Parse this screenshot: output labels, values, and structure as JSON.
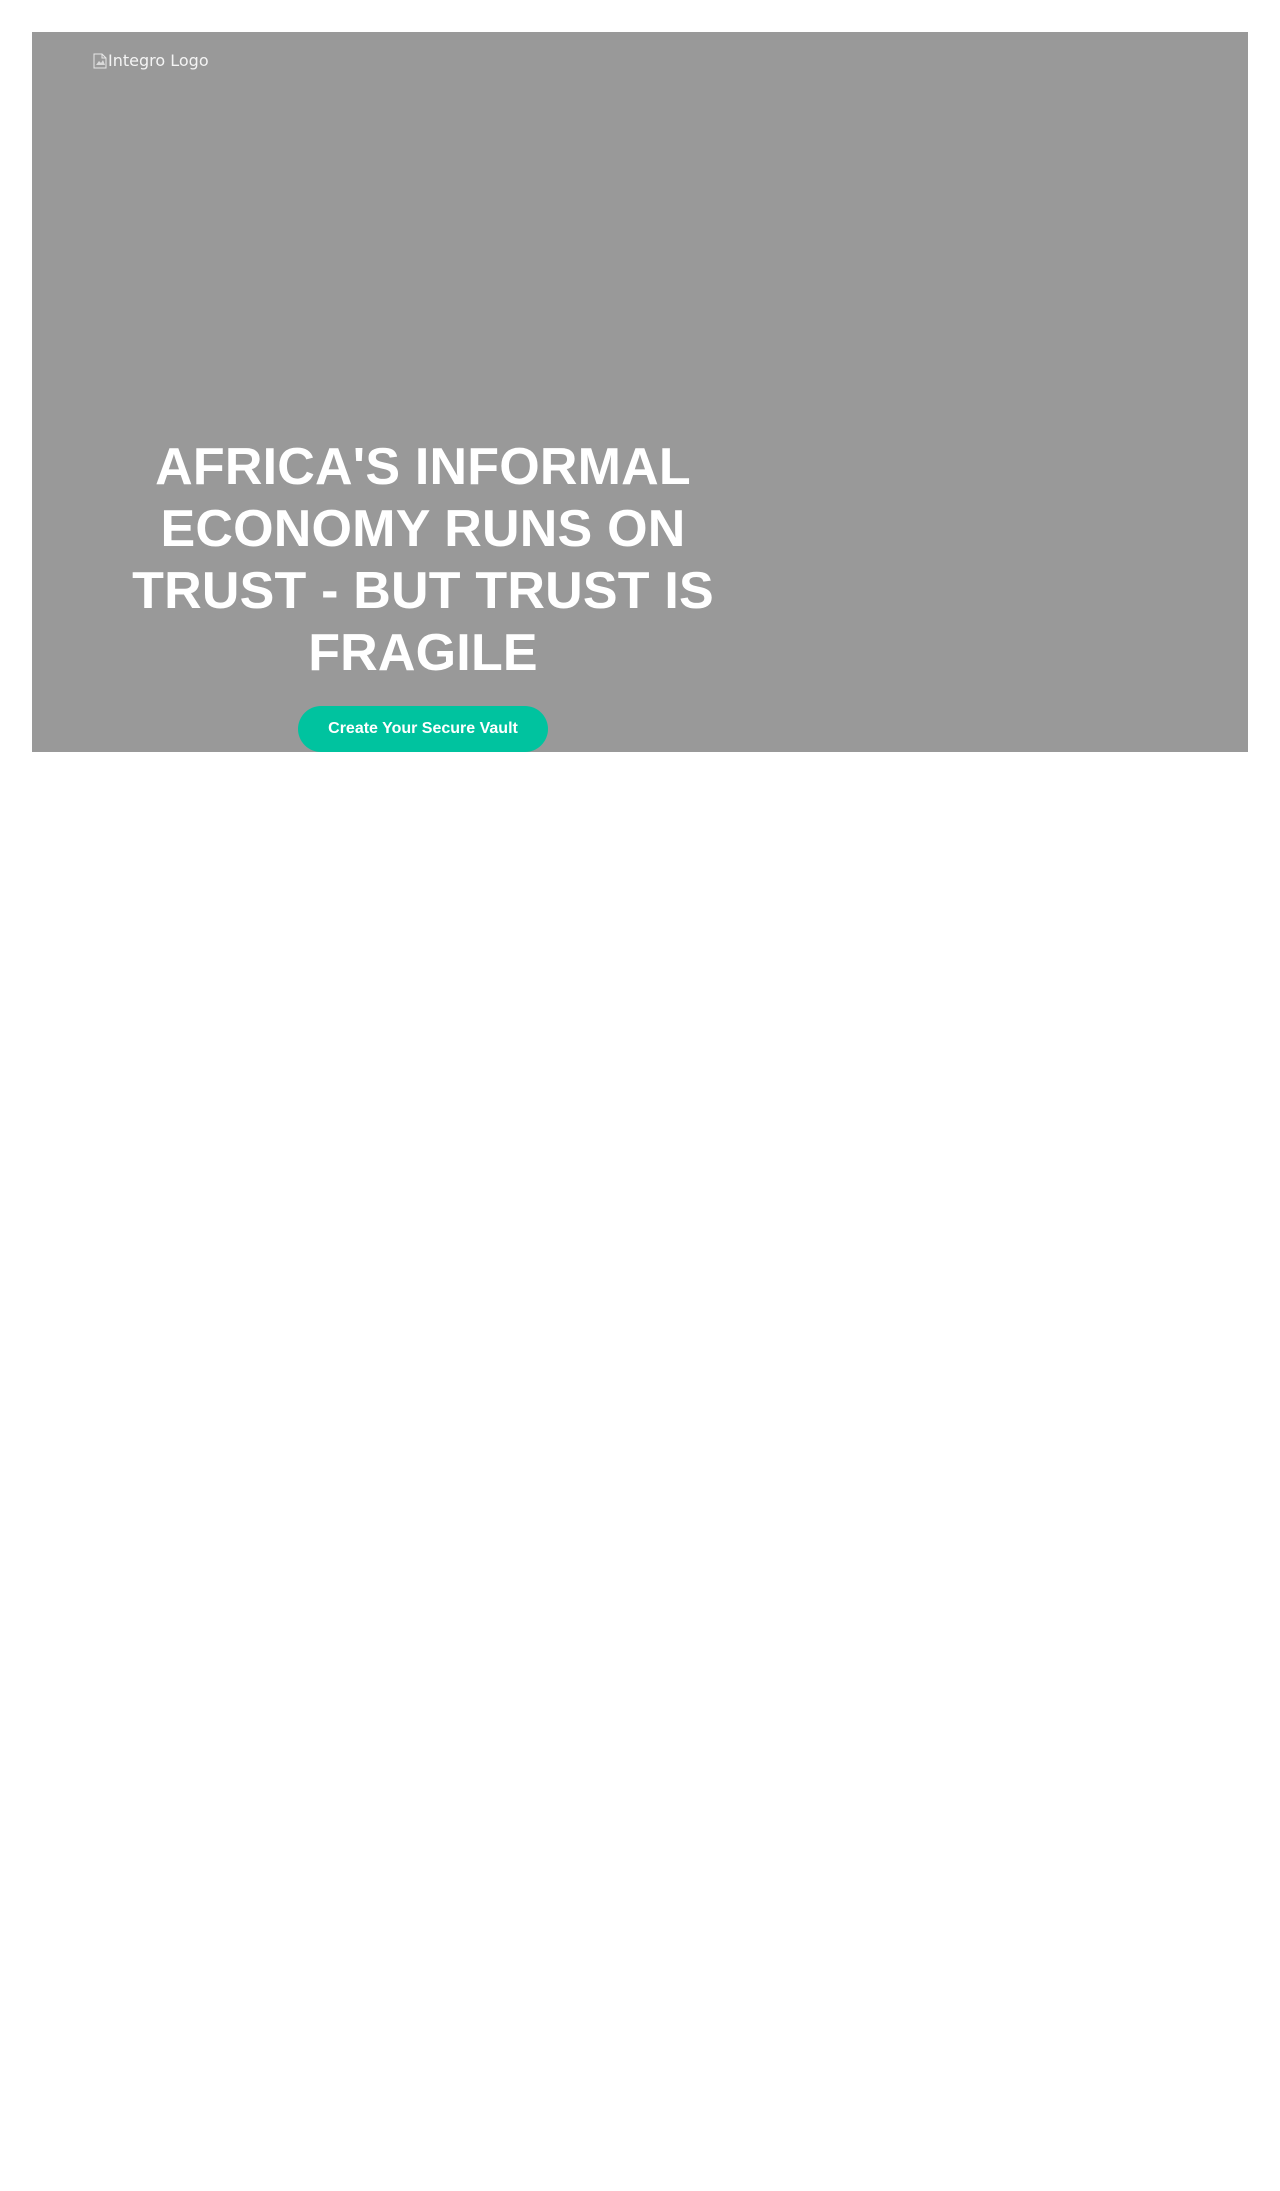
{
  "hero": {
    "logo_alt": "Integro Logo",
    "title": "AFRICA'S INFORMAL ECONOMY RUNS ON TRUST - BUT TRUST IS FRAGILE",
    "cta_label": "Create Your Secure Vault",
    "background_color": "#999999",
    "cta_color": "#00c39f"
  },
  "icons": {
    "logo": "broken-image-icon"
  }
}
